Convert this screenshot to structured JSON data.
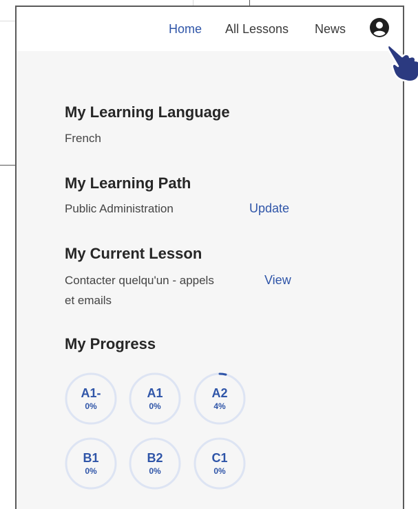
{
  "nav": {
    "home": "Home",
    "all_lessons": "All Lessons",
    "news": "News"
  },
  "icons": {
    "profile": "user-circle-icon",
    "pointer": "pointing-hand-icon"
  },
  "colors": {
    "accent": "#2f55a8",
    "ring": "#dde4f3"
  },
  "language": {
    "heading": "My Learning Language",
    "value": "French"
  },
  "path": {
    "heading": "My Learning Path",
    "value": "Public Administration",
    "action": "Update"
  },
  "lesson": {
    "heading": "My Current Lesson",
    "line1": "Contacter quelqu'un - appels",
    "line2": "et emails",
    "action": "View"
  },
  "progress": {
    "heading": "My Progress",
    "levels": [
      {
        "label": "A1-",
        "percent_label": "0%",
        "percent": 0
      },
      {
        "label": "A1",
        "percent_label": "0%",
        "percent": 0
      },
      {
        "label": "A2",
        "percent_label": "4%",
        "percent": 4
      },
      {
        "label": "B1",
        "percent_label": "0%",
        "percent": 0
      },
      {
        "label": "B2",
        "percent_label": "0%",
        "percent": 0
      },
      {
        "label": "C1",
        "percent_label": "0%",
        "percent": 0
      }
    ]
  }
}
